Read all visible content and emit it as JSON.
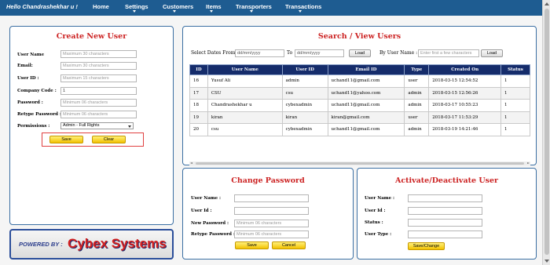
{
  "nav": {
    "greeting": "Hello Chandrashekhar u !",
    "items": [
      {
        "label": "Home"
      },
      {
        "label": "Settings"
      },
      {
        "label": "Customers"
      },
      {
        "label": "Items"
      },
      {
        "label": "Transporters"
      },
      {
        "label": "Transactions"
      }
    ]
  },
  "create_user": {
    "title": "Create New User",
    "fields": [
      {
        "label": "User Name",
        "placeholder": "Maximum 30 characters"
      },
      {
        "label": "Email:",
        "placeholder": "Maximum 30 characters"
      },
      {
        "label": "User ID :",
        "placeholder": "Maximum 15 characters"
      },
      {
        "label": "Company Code :",
        "value": "1"
      },
      {
        "label": "Password :",
        "placeholder": "Minimum 06 characters"
      },
      {
        "label": "Retype Password :",
        "placeholder": "Minimum 06 characters"
      },
      {
        "label": "Permissions :",
        "selected": "Admin - Full Rights"
      }
    ],
    "save_label": "Save",
    "clear_label": "Clear"
  },
  "search": {
    "title": "Search / View Users",
    "dates_from_label": "Select Dates From:",
    "date_placeholder": "dd/mm/yyyy",
    "to_label": "To",
    "load_label": "Load",
    "by_user_label": "By User Name :",
    "user_placeholder": "Enter first a few characters",
    "columns": [
      "ID",
      "User Name",
      "User ID",
      "Email ID",
      "Type",
      "Created On",
      "Status"
    ],
    "rows": [
      [
        "16",
        "Yusuf Ali",
        "admin",
        "uchand11@gmail.com",
        "user",
        "2018-03-15 12:54:52",
        "1"
      ],
      [
        "17",
        "CSU",
        "csu",
        "uchand11@yahoo.com",
        "admin",
        "2018-03-15 12:56:26",
        "1"
      ],
      [
        "18",
        "Chandrashekhar u",
        "cybexadmin",
        "uchand11@gmail.com",
        "admin",
        "2018-03-17 10:55:23",
        "1"
      ],
      [
        "19",
        "kiran",
        "kiran",
        "kiran@gmail.com",
        "user",
        "2018-03-17 11:53:29",
        "1"
      ],
      [
        "20",
        "csu",
        "cybexadmin",
        "uchand11@gmail.com",
        "admin",
        "2018-03-19 14:21:46",
        "1"
      ]
    ]
  },
  "change_password": {
    "title": "Change Password",
    "fields": [
      {
        "label": "User Name :",
        "placeholder": ""
      },
      {
        "label": "User Id :",
        "placeholder": ""
      },
      {
        "label": "New Password :",
        "placeholder": "Minimum 06 characters"
      },
      {
        "label": "Retype Password :",
        "placeholder": "Minimum 06 characters"
      }
    ],
    "save_label": "Save",
    "cancel_label": "Cancel"
  },
  "activate": {
    "title": "Activate/Deactivate User",
    "fields": [
      {
        "label": "User Name :"
      },
      {
        "label": "User Id :"
      },
      {
        "label": "Status :"
      },
      {
        "label": "User Type :"
      }
    ],
    "button_label": "Save/Change"
  },
  "powered": {
    "by_label": "POWERED BY :",
    "company": "Cybex Systems"
  },
  "colors": {
    "nav_bg": "#1e5c91",
    "panel_title": "#cc2222",
    "table_header": "#152c6b",
    "button_yellow": "#f3c200"
  }
}
